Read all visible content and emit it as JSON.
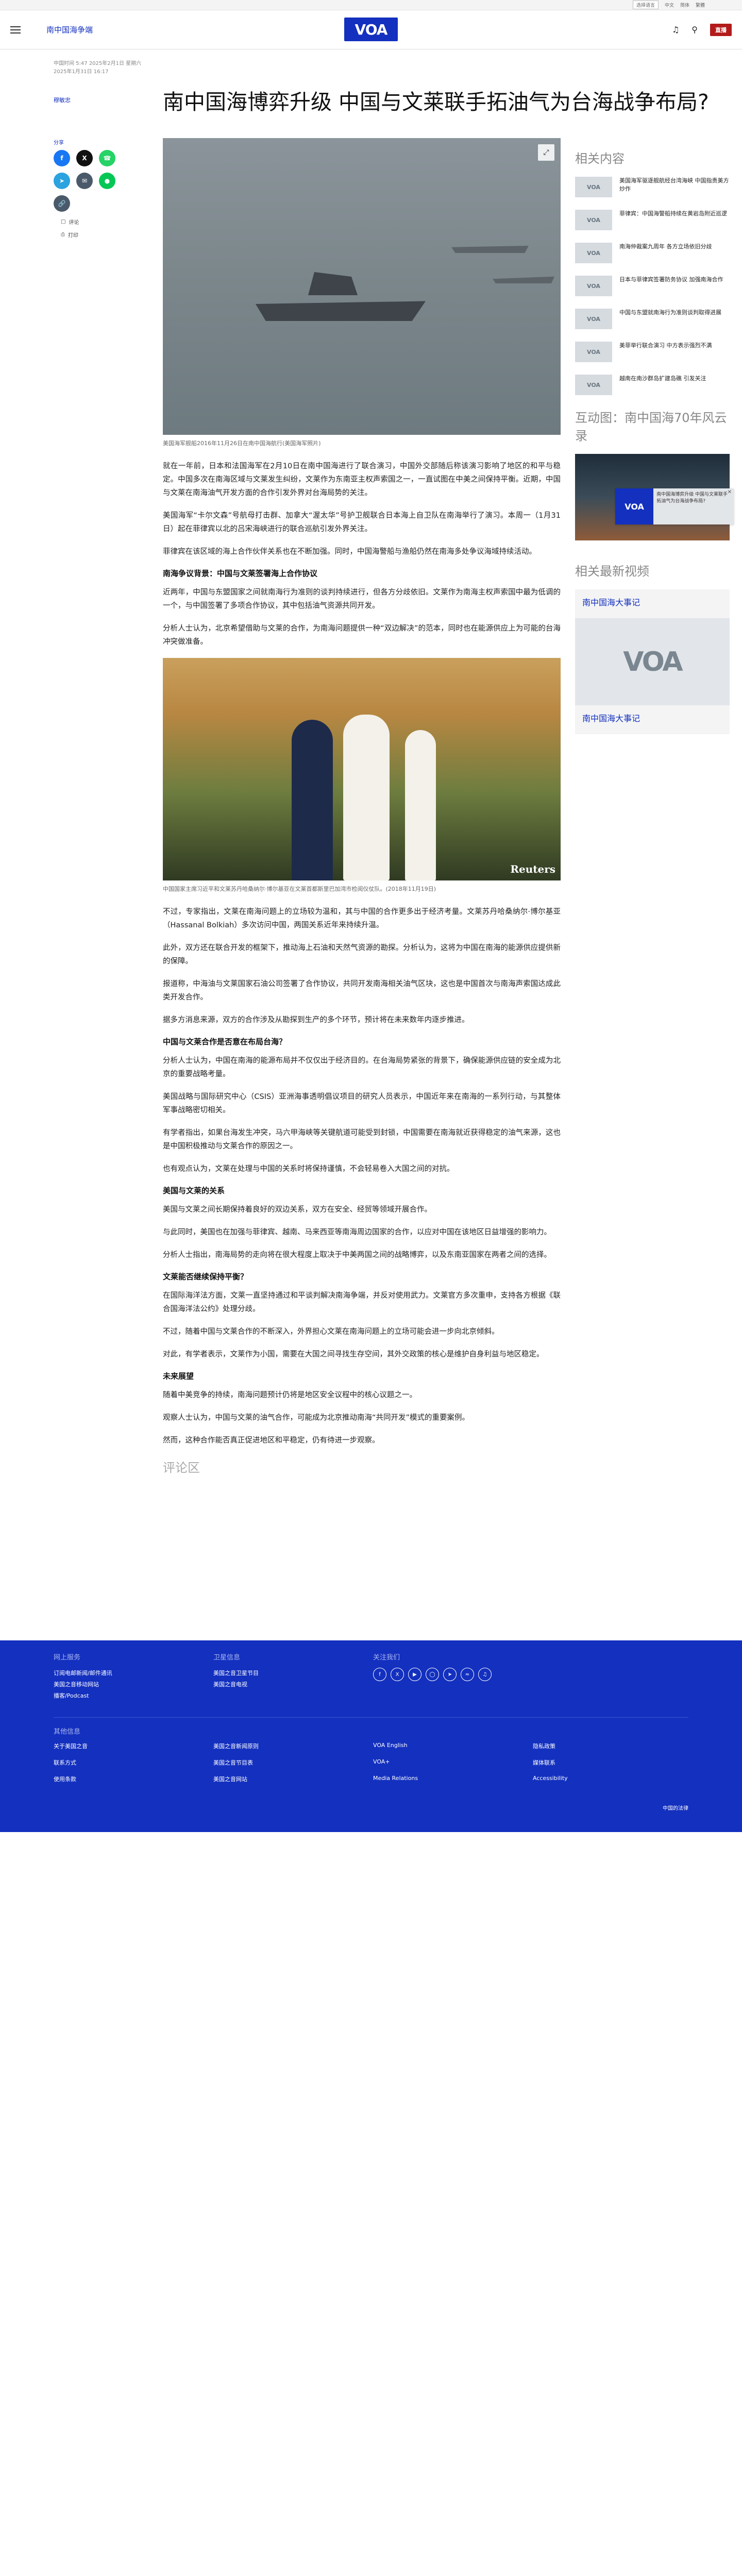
{
  "utilbar": {
    "language": "选择语言",
    "items": [
      "中文",
      "简体",
      "繁體"
    ]
  },
  "header": {
    "section": "南中国海争端",
    "logo": "VOA",
    "live": "直播"
  },
  "article": {
    "meta1": "中国时间 5:47 2025年2月1日 星期六",
    "meta2": "2025年1月31日 16:17",
    "author": "穆敏忠",
    "title": "南中国海博弈升级 中国与文莱联手拓油气为台海战争布局?",
    "share_title": "分享",
    "share_links": [
      "评论",
      "打印"
    ],
    "hero_caption": "美国海军舰船2016年11月26日在南中国海航行(美国海军照片)",
    "photo2_caption": "中国国家主席习近平和文莱苏丹哈桑纳尔·博尔基亚在文莱首都斯里巴加湾市检阅仪仗队。(2018年11月19日)",
    "photo2_watermark": "Reuters",
    "paragraphs_a": [
      "就在一年前，日本和法国海军在2月10日在南中国海进行了联合演习，中国外交部随后称该演习影响了地区的和平与稳定。中国多次在南海区域与文莱发生纠纷，文莱作为东南亚主权声索国之一，一直试图在中美之间保持平衡。近期，中国与文莱在南海油气开发方面的合作引发外界对台海局势的关注。",
      "美国海军“卡尔文森”号航母打击群、加拿大“渥太华”号护卫舰联合日本海上自卫队在南海举行了演习。本周一（1月31日）起在菲律宾以北的吕宋海峡进行的联合巡航引发外界关注。",
      "菲律宾在该区域的海上合作伙伴关系也在不断加强。同时，中国海警船与渔船仍然在南海多处争议海域持续活动。"
    ],
    "h3_1": "南海争议背景：中国与文莱签署海上合作协议",
    "paragraphs_b": [
      "近两年，中国与东盟国家之间就南海行为准则的谈判持续进行，但各方分歧依旧。文莱作为南海主权声索国中最为低调的一个，与中国签署了多项合作协议，其中包括油气资源共同开发。",
      "分析人士认为，北京希望借助与文莱的合作，为南海问题提供一种“双边解决”的范本，同时也在能源供应上为可能的台海冲突做准备。"
    ],
    "paragraphs_c": [
      "不过，专家指出，文莱在南海问题上的立场较为温和，其与中国的合作更多出于经济考量。文莱苏丹哈桑纳尔·博尔基亚（Hassanal Bolkiah）多次访问中国，两国关系近年来持续升温。",
      "此外，双方还在联合开发的框架下，推动海上石油和天然气资源的勘探。分析认为，这将为中国在南海的能源供应提供新的保障。",
      "报道称，中海油与文莱国家石油公司签署了合作协议，共同开发南海相关油气区块，这也是中国首次与南海声索国达成此类开发合作。",
      "据多方消息来源，双方的合作涉及从勘探到生产的多个环节，预计将在未来数年内逐步推进。"
    ],
    "h3_2": "中国与文莱合作是否意在布局台海？",
    "paragraphs_d": [
      "分析人士认为，中国在南海的能源布局并不仅仅出于经济目的。在台海局势紧张的背景下，确保能源供应链的安全成为北京的重要战略考量。",
      "美国战略与国际研究中心（CSIS）亚洲海事透明倡议项目的研究人员表示，中国近年来在南海的一系列行动，与其整体军事战略密切相关。",
      "有学者指出，如果台海发生冲突，马六甲海峡等关键航道可能受到封锁，中国需要在南海就近获得稳定的油气来源，这也是中国积极推动与文莱合作的原因之一。",
      "也有观点认为，文莱在处理与中国的关系时将保持谨慎，不会轻易卷入大国之间的对抗。"
    ],
    "h3_3": "美国与文莱的关系",
    "paragraphs_e": [
      "美国与文莱之间长期保持着良好的双边关系，双方在安全、经贸等领域开展合作。",
      "与此同时，美国也在加强与菲律宾、越南、马来西亚等南海周边国家的合作，以应对中国在该地区日益增强的影响力。",
      "分析人士指出，南海局势的走向将在很大程度上取决于中美两国之间的战略博弈，以及东南亚国家在两者之间的选择。"
    ],
    "h3_4": "文莱能否继续保持平衡？",
    "paragraphs_f": [
      "在国际海洋法方面，文莱一直坚持通过和平谈判解决南海争端，并反对使用武力。文莱官方多次重申，支持各方根据《联合国海洋法公约》处理分歧。",
      "不过，随着中国与文莱合作的不断深入，外界担心文莱在南海问题上的立场可能会进一步向北京倾斜。",
      "对此，有学者表示，文莱作为小国，需要在大国之间寻找生存空间，其外交政策的核心是维护自身利益与地区稳定。"
    ],
    "h3_5": "未来展望",
    "paragraphs_g": [
      "随着中美竞争的持续，南海问题预计仍将是地区安全议程中的核心议题之一。",
      "观察人士认为，中国与文莱的油气合作，可能成为北京推动南海“共同开发”模式的重要案例。",
      "然而，这种合作能否真正促进地区和平稳定，仍有待进一步观察。"
    ],
    "comments_label": "评论区"
  },
  "sidebar": {
    "related_title": "相关内容",
    "related": [
      {
        "text": "美国海军驱逐舰航经台湾海峡 中国指责美方炒作",
        "thumb": "VOA"
      },
      {
        "text": "菲律宾：中国海警船持续在黄岩岛附近巡逻",
        "thumb": "VOA"
      },
      {
        "text": "南海仲裁案九周年 各方立场依旧分歧",
        "thumb": "VOA"
      },
      {
        "text": "日本与菲律宾签署防务协议 加强南海合作",
        "thumb": "VOA"
      },
      {
        "text": "中国与东盟就南海行为准则谈判取得进展",
        "thumb": "VOA"
      },
      {
        "text": "美菲举行联合演习 中方表示强烈不满",
        "thumb": "VOA"
      },
      {
        "text": "越南在南沙群岛扩建岛礁 引发关注",
        "thumb": "VOA"
      }
    ],
    "interactive_title": "互动图：南中国海70年风云录",
    "infographic_title": "相关最新视频",
    "video_title": "南中国海大事记",
    "video_caption": "南中国海大事记"
  },
  "mini_player": {
    "text": "南中国海博弈升级 中国与文莱联手拓油气为台海战争布局?",
    "thumb": "VOA"
  },
  "footer": {
    "col1_title": "网上服务",
    "col1_links": [
      "订阅电邮新闻/邮件通讯",
      "美国之音移动网站",
      "播客/Podcast"
    ],
    "col2_title": "卫星信息",
    "col2_links": [
      "美国之音卫星节目",
      "美国之音电视"
    ],
    "col3_title": "关注我们",
    "other_title": "其他信息",
    "grid": [
      "关于美国之音",
      "美国之音新闻原则",
      "VOA English",
      "隐私政策",
      "联系方式",
      "美国之音节目表",
      "VOA+",
      "媒体联系",
      "使用条款",
      "美国之音网站",
      "Media Relations",
      "Accessibility"
    ],
    "copyright": "中国的法律"
  },
  "colors": {
    "brand": "#1330bf",
    "live": "#b31b1b"
  }
}
